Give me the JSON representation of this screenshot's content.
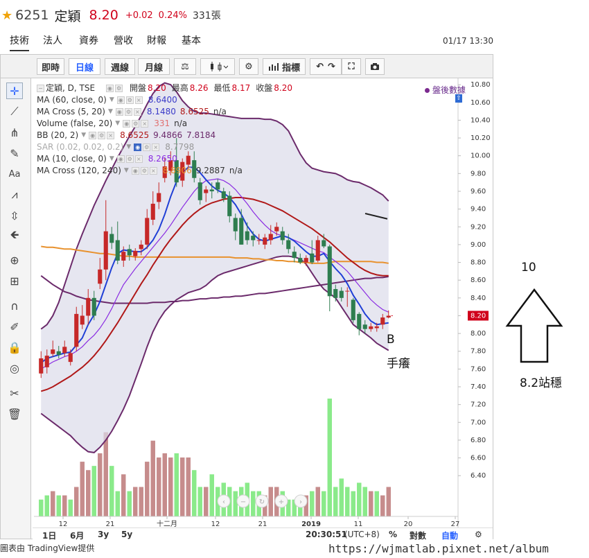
{
  "quote": {
    "code": "6251",
    "name": "定穎",
    "price": "8.20",
    "change": "+0.02",
    "change_pct": "0.24%",
    "volume": "331張"
  },
  "nav": {
    "tabs": [
      "技術",
      "法人",
      "資券",
      "營收",
      "財報",
      "基本"
    ],
    "active": 0,
    "datetime": "01/17 13:30"
  },
  "toolbar": {
    "buttons": [
      "即時",
      "日線",
      "週線",
      "月線"
    ],
    "active": 1,
    "indicators_label": "指標"
  },
  "legend": {
    "symbol": "定穎, D, TSE",
    "open_label": "開盤",
    "open": "8.20",
    "high_label": "最高",
    "high": "8.26",
    "low_label": "最低",
    "low": "8.17",
    "close_label": "收盤",
    "close": "8.20",
    "rows": [
      {
        "name": "MA (60, close, 0)",
        "values": [
          "8.6400"
        ],
        "colors": [
          "#3a3ac8"
        ]
      },
      {
        "name": "MA Cross (5, 20)",
        "values": [
          "8.1480",
          "8.6525",
          "n/a"
        ],
        "colors": [
          "#3a3ac8",
          "#b01818",
          "#333333"
        ]
      },
      {
        "name": "Volume (false, 20)",
        "values": [
          "331",
          "n/a"
        ],
        "colors": [
          "#e07070",
          "#333333"
        ]
      },
      {
        "name": "BB (20, 2)",
        "values": [
          "8.6525",
          "9.4866",
          "7.8184"
        ],
        "colors": [
          "#b01818",
          "#6b2a6b",
          "#6b2a6b"
        ]
      },
      {
        "name": "SAR (0.02, 0.02, 0.2)",
        "values": [
          "8.7798"
        ],
        "colors": [
          "#999999"
        ]
      },
      {
        "name": "MA (10, close, 0)",
        "values": [
          "8.2650"
        ],
        "colors": [
          "#8a2be2"
        ]
      },
      {
        "name": "MA Cross (120, 240)",
        "values": [
          "8.8906",
          "9.2887",
          "n/a"
        ],
        "colors": [
          "#e8912d",
          "#333333",
          "#333333"
        ]
      }
    ],
    "after_hours": "盤後數據"
  },
  "bottom_bar": {
    "ranges": [
      "1日",
      "6月",
      "3y",
      "5y"
    ],
    "time": "20:30:51",
    "tz": "(UTC+8)",
    "pct": "%",
    "log": "對數",
    "auto": "自動"
  },
  "footer": {
    "credit": "圖表由 TradingView提供",
    "watermark": "https://wjmatlab.pixnet.net/album"
  },
  "annotations": {
    "b": "B",
    "hand_itch": "手癢",
    "target": "10",
    "stable": "8.2站穩"
  },
  "chart_data": {
    "type": "candlestick",
    "y_ticks": [
      "10.80",
      "10.60",
      "10.40",
      "10.20",
      "10.00",
      "9.80",
      "9.60",
      "9.40",
      "9.20",
      "9.00",
      "8.80",
      "8.60",
      "8.40",
      "8.20",
      "8.00",
      "7.80",
      "7.60",
      "7.40",
      "7.20",
      "7.00",
      "6.80",
      "6.60",
      "6.40"
    ],
    "x_ticks": [
      "12",
      "21",
      "十二月",
      "12",
      "21",
      "2019",
      "11",
      "20",
      "27"
    ],
    "last_price_tag": "8.20",
    "colors": {
      "up": "#c62828",
      "down": "#2e7d4f",
      "ma5": "#1f3fd6",
      "ma10": "#8a2be2",
      "ma20": "#b01818",
      "ma120": "#e8912d",
      "bb": "#6b2a6b",
      "bb_fill": "#dcdcea",
      "vol_up": "#c08080",
      "vol_down": "#7de87d"
    },
    "candles": [
      {
        "o": 7.55,
        "c": 7.72,
        "h": 7.8,
        "l": 7.5
      },
      {
        "o": 7.62,
        "c": 7.75,
        "h": 7.82,
        "l": 7.55
      },
      {
        "o": 7.77,
        "c": 7.82,
        "h": 7.92,
        "l": 7.74
      },
      {
        "o": 7.8,
        "c": 7.76,
        "h": 7.86,
        "l": 7.72
      },
      {
        "o": 7.78,
        "c": 7.85,
        "h": 7.92,
        "l": 7.74
      },
      {
        "o": 7.68,
        "c": 7.78,
        "h": 7.82,
        "l": 7.64
      },
      {
        "o": 7.85,
        "c": 8.22,
        "h": 8.3,
        "l": 7.8
      },
      {
        "o": 8.1,
        "c": 8.2,
        "h": 8.32,
        "l": 8.05
      },
      {
        "o": 8.2,
        "c": 8.4,
        "h": 8.5,
        "l": 8.1
      },
      {
        "o": 8.4,
        "c": 8.2,
        "h": 8.48,
        "l": 8.15
      },
      {
        "o": 8.56,
        "c": 8.72,
        "h": 8.85,
        "l": 8.5
      },
      {
        "o": 8.72,
        "c": 9.15,
        "h": 9.5,
        "l": 8.6
      },
      {
        "o": 9.12,
        "c": 9.02,
        "h": 9.2,
        "l": 8.95
      },
      {
        "o": 9.05,
        "c": 8.82,
        "h": 9.26,
        "l": 8.78
      },
      {
        "o": 8.82,
        "c": 8.92,
        "h": 8.98,
        "l": 8.75
      },
      {
        "o": 8.95,
        "c": 8.88,
        "h": 9.0,
        "l": 8.82
      },
      {
        "o": 8.87,
        "c": 8.93,
        "h": 8.96,
        "l": 8.82
      },
      {
        "o": 8.95,
        "c": 9.0,
        "h": 9.05,
        "l": 8.88
      },
      {
        "o": 9.0,
        "c": 9.3,
        "h": 9.4,
        "l": 8.95
      },
      {
        "o": 9.28,
        "c": 9.46,
        "h": 9.6,
        "l": 9.22
      },
      {
        "o": 9.48,
        "c": 9.58,
        "h": 9.7,
        "l": 9.4
      },
      {
        "o": 9.75,
        "c": 9.88,
        "h": 9.98,
        "l": 9.7
      },
      {
        "o": 9.83,
        "c": 9.95,
        "h": 10.05,
        "l": 9.78
      },
      {
        "o": 9.95,
        "c": 9.7,
        "h": 10.2,
        "l": 9.65
      },
      {
        "o": 9.72,
        "c": 9.93,
        "h": 9.97,
        "l": 9.65
      },
      {
        "o": 9.9,
        "c": 10.0,
        "h": 10.05,
        "l": 9.85
      },
      {
        "o": 9.95,
        "c": 9.75,
        "h": 10.05,
        "l": 9.7
      },
      {
        "o": 9.7,
        "c": 9.5,
        "h": 9.75,
        "l": 9.45
      },
      {
        "o": 9.58,
        "c": 9.62,
        "h": 9.66,
        "l": 9.48
      },
      {
        "o": 9.62,
        "c": 9.6,
        "h": 9.7,
        "l": 9.52
      },
      {
        "o": 9.7,
        "c": 9.62,
        "h": 9.74,
        "l": 9.58
      },
      {
        "o": 9.6,
        "c": 9.52,
        "h": 9.64,
        "l": 9.48
      },
      {
        "o": 9.55,
        "c": 9.32,
        "h": 9.6,
        "l": 9.25
      },
      {
        "o": 9.3,
        "c": 9.15,
        "h": 9.35,
        "l": 9.05
      },
      {
        "o": 9.3,
        "c": 9.0,
        "h": 9.4,
        "l": 9.0
      },
      {
        "o": 9.15,
        "c": 9.05,
        "h": 9.25,
        "l": 9.0
      },
      {
        "o": 9.1,
        "c": 9.05,
        "h": 9.15,
        "l": 8.98
      },
      {
        "o": 9.05,
        "c": 9.05,
        "h": 9.12,
        "l": 9.0
      },
      {
        "o": 9.0,
        "c": 9.08,
        "h": 9.12,
        "l": 8.95
      },
      {
        "o": 9.05,
        "c": 9.12,
        "h": 9.22,
        "l": 9.0
      },
      {
        "o": 9.15,
        "c": 9.2,
        "h": 9.25,
        "l": 9.1
      },
      {
        "o": 9.15,
        "c": 9.05,
        "h": 9.2,
        "l": 9.0
      },
      {
        "o": 9.05,
        "c": 8.95,
        "h": 9.12,
        "l": 8.9
      },
      {
        "o": 8.92,
        "c": 8.85,
        "h": 8.98,
        "l": 8.8
      },
      {
        "o": 8.85,
        "c": 8.8,
        "h": 8.9,
        "l": 8.78
      },
      {
        "o": 8.8,
        "c": 8.85,
        "h": 8.88,
        "l": 8.76
      },
      {
        "o": 8.9,
        "c": 8.8,
        "h": 9.05,
        "l": 8.78
      },
      {
        "o": 8.82,
        "c": 9.05,
        "h": 9.1,
        "l": 8.8
      },
      {
        "o": 9.05,
        "c": 8.98,
        "h": 9.12,
        "l": 8.96
      },
      {
        "o": 8.98,
        "c": 8.42,
        "h": 9.0,
        "l": 8.25
      },
      {
        "o": 8.5,
        "c": 8.4,
        "h": 8.55,
        "l": 8.36
      },
      {
        "o": 8.48,
        "c": 8.4,
        "h": 8.52,
        "l": 8.36
      },
      {
        "o": 8.48,
        "c": 8.48,
        "h": 8.52,
        "l": 8.3
      },
      {
        "o": 8.38,
        "c": 8.15,
        "h": 8.4,
        "l": 8.12
      },
      {
        "o": 8.22,
        "c": 8.05,
        "h": 8.24,
        "l": 7.98
      },
      {
        "o": 8.1,
        "c": 8.05,
        "h": 8.15,
        "l": 8.0
      },
      {
        "o": 8.05,
        "c": 8.08,
        "h": 8.12,
        "l": 8.02
      },
      {
        "o": 8.06,
        "c": 8.08,
        "h": 8.12,
        "l": 8.02
      },
      {
        "o": 8.1,
        "c": 8.18,
        "h": 8.22,
        "l": 8.05
      },
      {
        "o": 8.18,
        "c": 8.2,
        "h": 8.26,
        "l": 8.17
      }
    ],
    "volume": [
      8,
      10,
      12,
      10,
      10,
      8,
      14,
      26,
      22,
      24,
      30,
      40,
      24,
      12,
      20,
      12,
      14,
      14,
      26,
      36,
      28,
      30,
      28,
      30,
      28,
      28,
      22,
      14,
      14,
      20,
      14,
      16,
      14,
      12,
      14,
      16,
      12,
      12,
      10,
      14,
      14,
      12,
      8,
      8,
      10,
      10,
      12,
      14,
      12,
      56,
      14,
      18,
      14,
      12,
      16,
      14,
      12,
      12,
      10,
      14
    ],
    "volume_up": [
      false,
      false,
      true,
      false,
      true,
      false,
      true,
      true,
      true,
      false,
      true,
      true,
      false,
      false,
      true,
      false,
      true,
      true,
      true,
      true,
      true,
      true,
      true,
      false,
      true,
      true,
      false,
      false,
      true,
      false,
      false,
      false,
      false,
      false,
      false,
      false,
      false,
      false,
      true,
      true,
      true,
      false,
      false,
      false,
      false,
      true,
      false,
      true,
      false,
      false,
      false,
      false,
      false,
      false,
      false,
      false,
      true,
      false,
      true,
      true
    ],
    "ma5": [
      7.67,
      7.72,
      7.74,
      7.76,
      7.78,
      7.79,
      7.87,
      7.95,
      8.1,
      8.21,
      8.36,
      8.55,
      8.74,
      8.9,
      8.94,
      8.93,
      8.92,
      8.92,
      8.97,
      9.05,
      9.17,
      9.34,
      9.54,
      9.71,
      9.81,
      9.87,
      9.87,
      9.81,
      9.73,
      9.66,
      9.61,
      9.58,
      9.53,
      9.45,
      9.34,
      9.21,
      9.12,
      9.06,
      9.04,
      9.06,
      9.08,
      9.1,
      9.08,
      9.04,
      8.98,
      8.92,
      8.87,
      8.87,
      8.9,
      8.81,
      8.73,
      8.66,
      8.56,
      8.43,
      8.33,
      8.22,
      8.14,
      8.1,
      8.11,
      8.12
    ],
    "ma10": [
      7.6,
      7.64,
      7.68,
      7.71,
      7.74,
      7.76,
      7.8,
      7.85,
      7.92,
      7.98,
      8.06,
      8.16,
      8.28,
      8.42,
      8.55,
      8.64,
      8.73,
      8.81,
      8.89,
      8.97,
      9.05,
      9.13,
      9.22,
      9.32,
      9.42,
      9.51,
      9.6,
      9.67,
      9.72,
      9.73,
      9.74,
      9.72,
      9.68,
      9.62,
      9.54,
      9.46,
      9.37,
      9.29,
      9.22,
      9.16,
      9.12,
      9.1,
      9.08,
      9.05,
      9.02,
      8.99,
      8.96,
      8.93,
      8.91,
      8.86,
      8.81,
      8.76,
      8.7,
      8.62,
      8.54,
      8.46,
      8.38,
      8.32,
      8.27,
      8.24
    ],
    "ma20": [
      7.35,
      7.37,
      7.4,
      7.44,
      7.48,
      7.52,
      7.57,
      7.62,
      7.68,
      7.75,
      7.83,
      7.92,
      8.02,
      8.12,
      8.23,
      8.34,
      8.45,
      8.56,
      8.66,
      8.77,
      8.87,
      8.97,
      9.06,
      9.14,
      9.22,
      9.29,
      9.35,
      9.4,
      9.44,
      9.47,
      9.49,
      9.51,
      9.52,
      9.53,
      9.53,
      9.52,
      9.51,
      9.49,
      9.47,
      9.44,
      9.41,
      9.38,
      9.34,
      9.3,
      9.26,
      9.22,
      9.18,
      9.13,
      9.08,
      9.03,
      8.97,
      8.91,
      8.85,
      8.8,
      8.75,
      8.71,
      8.68,
      8.66,
      8.65,
      8.65
    ],
    "bb_upper": [
      8.05,
      8.1,
      8.2,
      8.35,
      8.55,
      8.75,
      8.95,
      9.12,
      9.28,
      9.44,
      9.58,
      9.72,
      9.85,
      9.98,
      10.1,
      10.22,
      10.33,
      10.45,
      10.58,
      10.7,
      10.78,
      10.82,
      10.8,
      10.72,
      10.62,
      10.55,
      10.5,
      10.48,
      10.48,
      10.47,
      10.46,
      10.45,
      10.44,
      10.43,
      10.42,
      10.42,
      10.42,
      10.42,
      10.41,
      10.41,
      10.39,
      10.35,
      10.28,
      10.15,
      10.02,
      9.92,
      9.86,
      9.84,
      9.82,
      9.81,
      9.8,
      9.77,
      9.73,
      9.71,
      9.7,
      9.67,
      9.64,
      9.6,
      9.56,
      9.49
    ],
    "bb_lower": [
      7.1,
      7.05,
      7.0,
      6.95,
      6.9,
      6.85,
      6.78,
      6.72,
      6.67,
      6.66,
      6.72,
      6.8,
      6.9,
      7.02,
      7.15,
      7.3,
      7.48,
      7.66,
      7.85,
      8.02,
      8.15,
      8.25,
      8.32,
      8.38,
      8.42,
      8.46,
      8.48,
      8.5,
      8.54,
      8.6,
      8.65,
      8.68,
      8.7,
      8.72,
      8.74,
      8.76,
      8.78,
      8.8,
      8.82,
      8.84,
      8.86,
      8.87,
      8.87,
      8.86,
      8.84,
      8.78,
      8.68,
      8.58,
      8.5,
      8.45,
      8.4,
      8.3,
      8.2,
      8.1,
      8.05,
      8.0,
      7.95,
      7.89,
      7.85,
      7.81
    ],
    "ma120": [
      8.98,
      8.97,
      8.97,
      8.96,
      8.95,
      8.95,
      8.94,
      8.93,
      8.92,
      8.91,
      8.9,
      8.9,
      8.89,
      8.88,
      8.87,
      8.87,
      8.86,
      8.86,
      8.86,
      8.86,
      8.86,
      8.86,
      8.86,
      8.86,
      8.86,
      8.86,
      8.86,
      8.86,
      8.86,
      8.86,
      8.86,
      8.86,
      8.86,
      8.85,
      8.85,
      8.85,
      8.84,
      8.84,
      8.83,
      8.83,
      8.82,
      8.82,
      8.81,
      8.81,
      8.8,
      8.8,
      8.79,
      8.79,
      8.79,
      8.8,
      8.81,
      8.81,
      8.81,
      8.81,
      8.81,
      8.81,
      8.81,
      8.8,
      8.8,
      8.79
    ],
    "ma240": [
      8.65,
      8.6,
      8.55,
      8.51,
      8.47,
      8.45,
      8.42,
      8.4,
      8.38,
      8.37,
      8.36,
      8.35,
      8.34,
      8.34,
      8.34,
      8.34,
      8.34,
      8.34,
      8.34,
      8.35,
      8.35,
      8.35,
      8.36,
      8.36,
      8.37,
      8.37,
      8.38,
      8.39,
      8.39,
      8.4,
      8.4,
      8.41,
      8.41,
      8.42,
      8.42,
      8.43,
      8.44,
      8.45,
      8.45,
      8.46,
      8.47,
      8.48,
      8.49,
      8.5,
      8.51,
      8.52,
      8.53,
      8.54,
      8.55,
      8.56,
      8.57,
      8.58,
      8.59,
      8.6,
      8.61,
      8.62,
      8.62,
      8.63,
      8.63,
      8.64
    ]
  }
}
